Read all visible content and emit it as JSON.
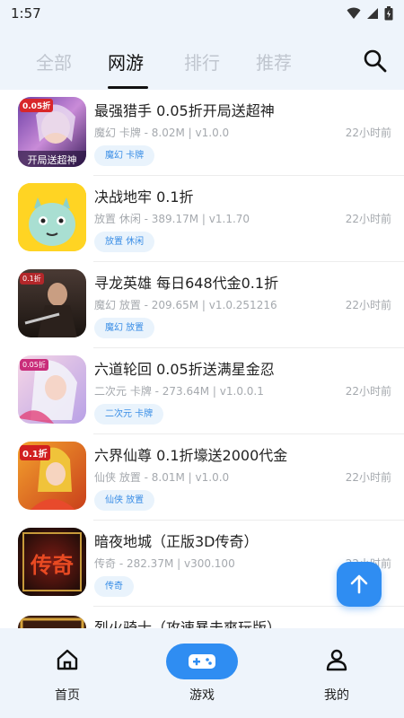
{
  "status": {
    "time": "1:57"
  },
  "tabs": [
    {
      "label": "全部",
      "active": false
    },
    {
      "label": "网游",
      "active": true
    },
    {
      "label": "排行",
      "active": false
    },
    {
      "label": "推荐",
      "active": false
    }
  ],
  "games": [
    {
      "title": "最强猎手 0.05折开局送超神",
      "meta": "魔幻 卡牌 - 8.02M | v1.0.0",
      "time": "22小时前",
      "tag": "魔幻 卡牌"
    },
    {
      "title": "决战地牢 0.1折",
      "meta": "放置 休闲 - 389.17M | v1.1.70",
      "time": "22小时前",
      "tag": "放置 休闲"
    },
    {
      "title": "寻龙英雄 每日648代金0.1折",
      "meta": "魔幻 放置 - 209.65M | v1.0.251216",
      "time": "22小时前",
      "tag": "魔幻 放置"
    },
    {
      "title": "六道轮回 0.05折送满星金忍",
      "meta": "二次元 卡牌 - 273.64M | v1.0.0.1",
      "time": "22小时前",
      "tag": "二次元 卡牌"
    },
    {
      "title": "六界仙尊 0.1折壕送2000代金",
      "meta": "仙侠 放置 - 8.01M | v1.0.0",
      "time": "22小时前",
      "tag": "仙侠 放置"
    },
    {
      "title": "暗夜地城（正版3D传奇）",
      "meta": "传奇 - 282.37M | v300.100",
      "time": "22小时前",
      "tag": "传奇"
    },
    {
      "title": "烈火骑士（攻速暴击爽玩版）",
      "meta": "",
      "time": "",
      "tag": ""
    }
  ],
  "thumb_badges": [
    "0.05折",
    "",
    "0.1折",
    "0.05折",
    "0.1折",
    "传奇",
    ""
  ],
  "nav": [
    {
      "label": "首页",
      "icon": "home-icon"
    },
    {
      "label": "游戏",
      "icon": "gamepad-icon",
      "active": true
    },
    {
      "label": "我的",
      "icon": "profile-icon"
    }
  ],
  "colors": {
    "accent": "#2f8df2",
    "tag_bg": "#e9f3fc",
    "tag_text": "#3a8ee6",
    "background": "#eef4fb"
  }
}
